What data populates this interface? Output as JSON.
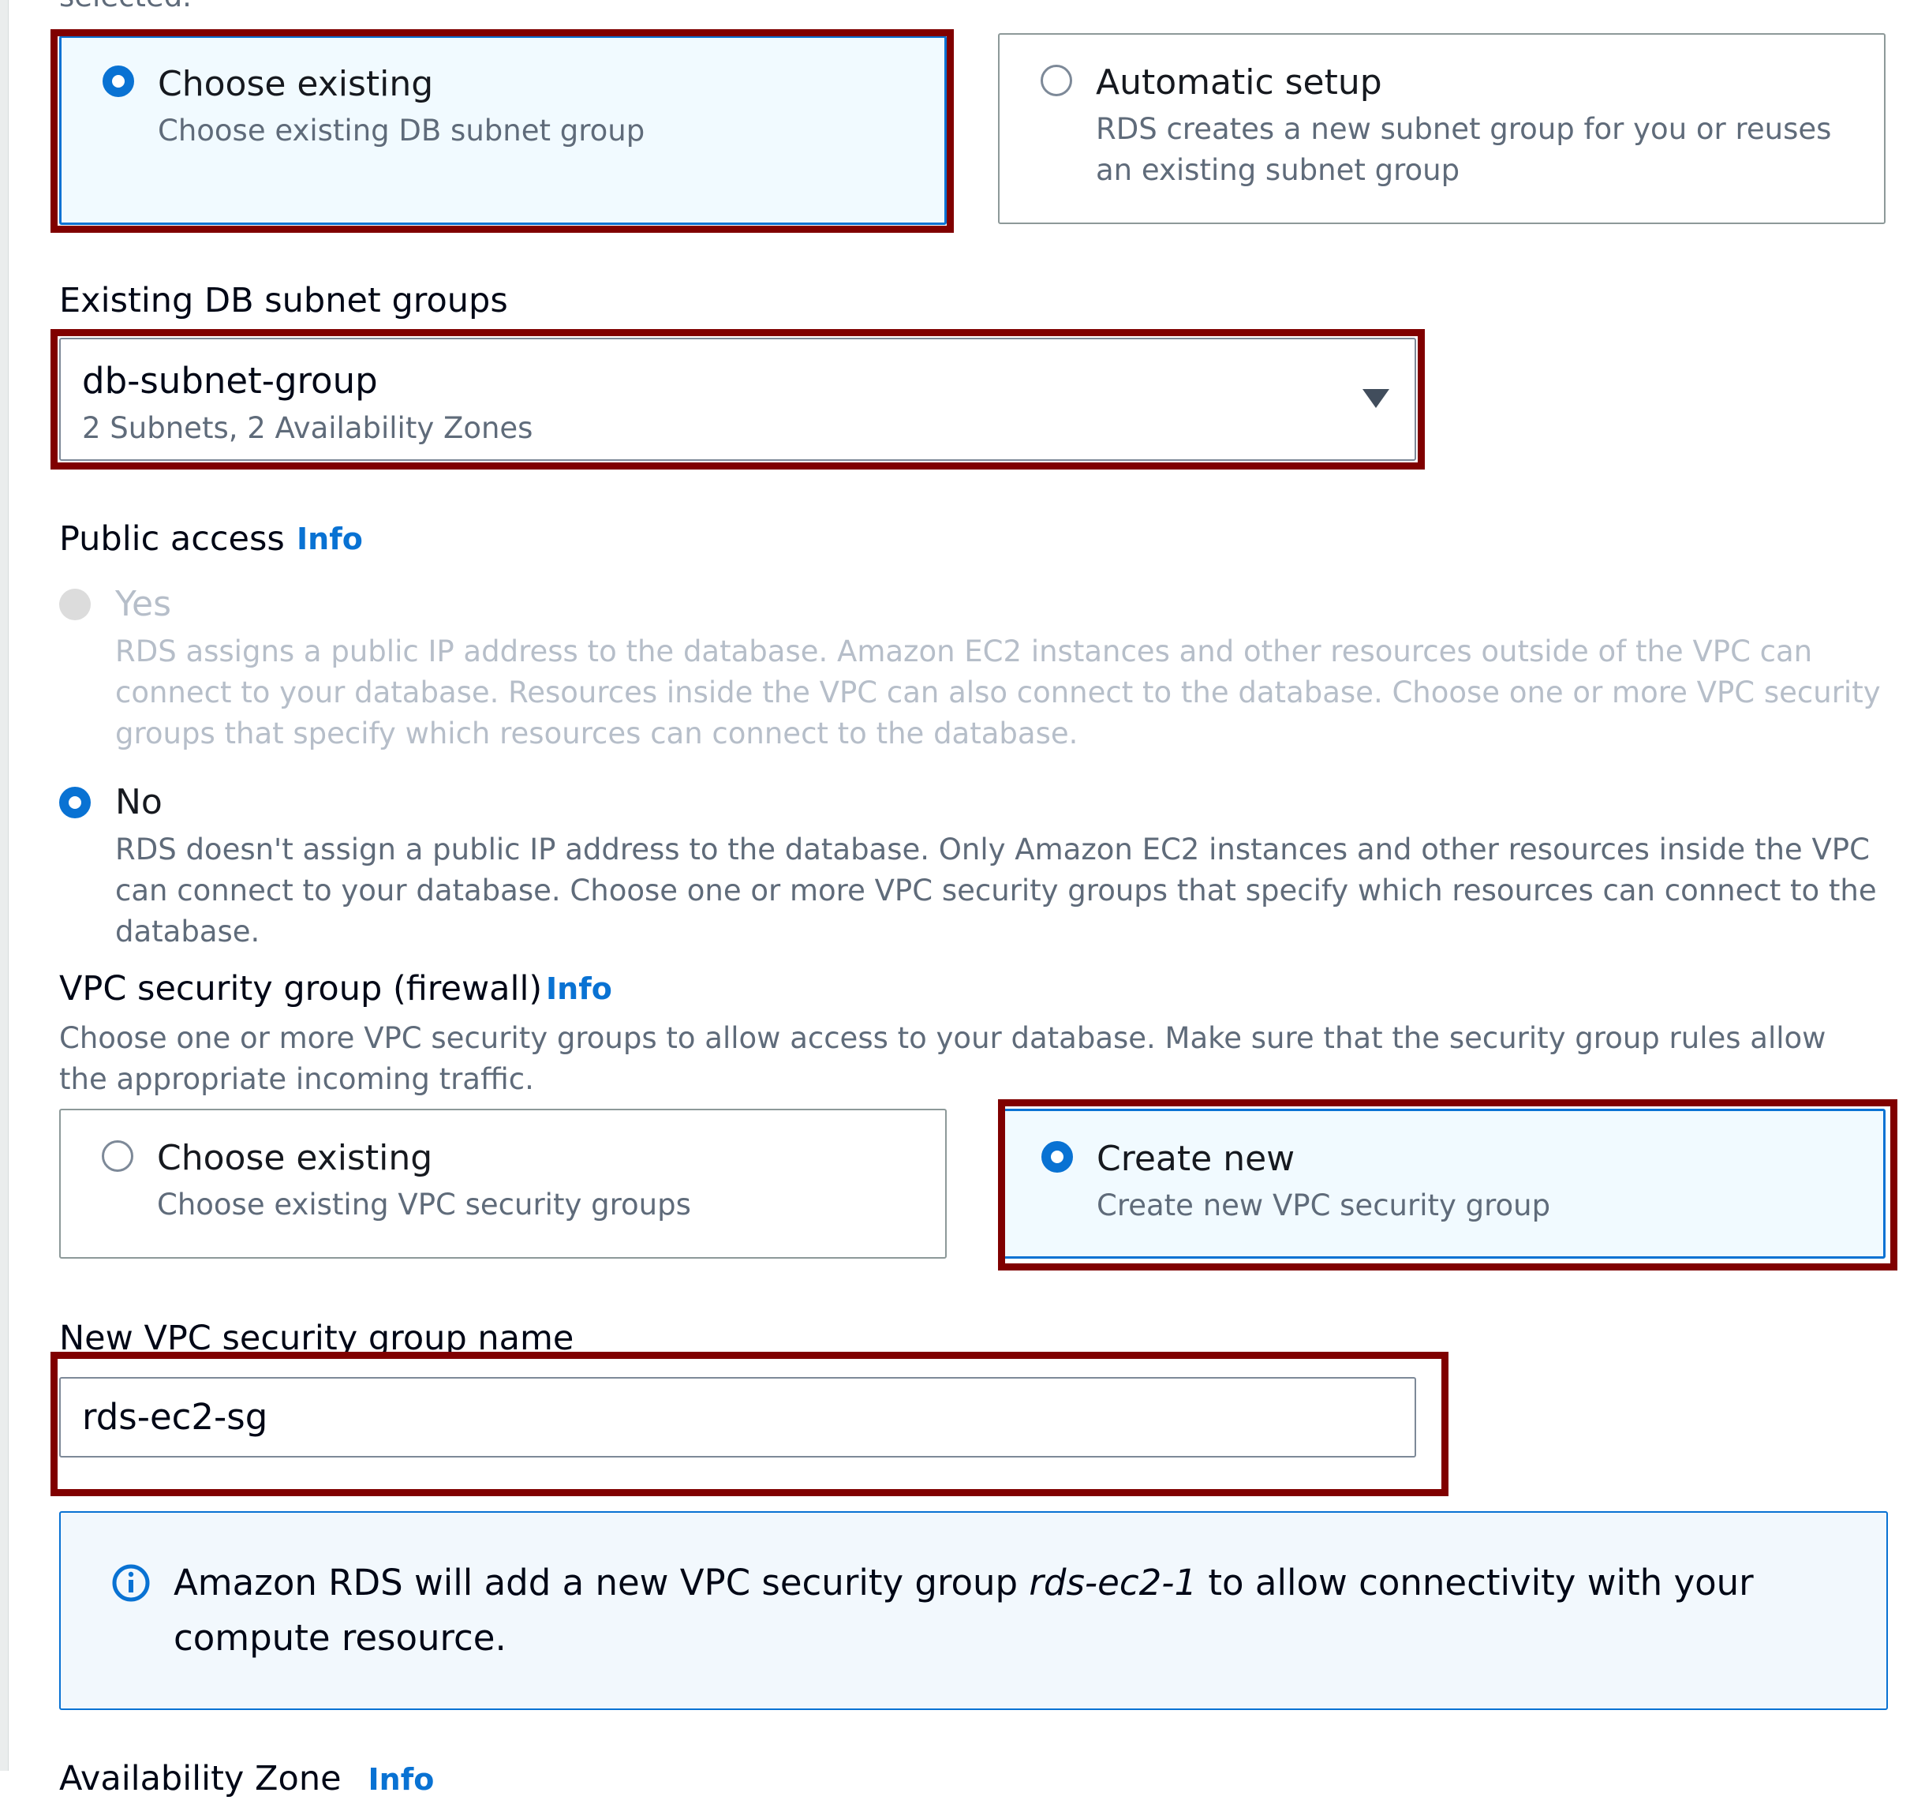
{
  "top_cut_text": "selected.",
  "subnet_choice": {
    "existing": {
      "title": "Choose existing",
      "desc": "Choose existing DB subnet group",
      "selected": true
    },
    "automatic": {
      "title": "Automatic setup",
      "desc": "RDS creates a new subnet group for you or reuses an existing subnet group",
      "selected": false
    }
  },
  "subnet_groups": {
    "label": "Existing DB subnet groups",
    "value": "db-subnet-group",
    "meta": "2 Subnets, 2 Availability Zones"
  },
  "public_access": {
    "label": "Public access",
    "info": "Info",
    "yes": {
      "title": "Yes",
      "desc": "RDS assigns a public IP address to the database. Amazon EC2 instances and other resources outside of the VPC can connect to your database. Resources inside the VPC can also connect to the database. Choose one or more VPC security groups that specify which resources can connect to the database.",
      "disabled": true
    },
    "no": {
      "title": "No",
      "desc": "RDS doesn't assign a public IP address to the database. Only Amazon EC2 instances and other resources inside the VPC can connect to your database. Choose one or more VPC security groups that specify which resources can connect to the database.",
      "selected": true
    }
  },
  "vpc_sg": {
    "label": "VPC security group (firewall)",
    "info": "Info",
    "desc": "Choose one or more VPC security groups to allow access to your database. Make sure that the security group rules allow the appropriate incoming traffic.",
    "existing": {
      "title": "Choose existing",
      "desc": "Choose existing VPC security groups",
      "selected": false
    },
    "new": {
      "title": "Create new",
      "desc": "Create new VPC security group",
      "selected": true
    }
  },
  "new_sg": {
    "label": "New VPC security group name",
    "value": "rds-ec2-sg"
  },
  "notice": {
    "icon": "info-circle-icon",
    "before": "Amazon RDS will add a new VPC security group ",
    "emph": "rds-ec2-1",
    "after": " to allow connectivity with your compute resource."
  },
  "bottom_cut_text": "Availability Zone",
  "bottom_cut_info": "Info",
  "colors": {
    "accent": "#0972d3",
    "highlight": "#800000",
    "selected_bg": "#f1faff",
    "notice_bg": "#f2f8fd"
  }
}
